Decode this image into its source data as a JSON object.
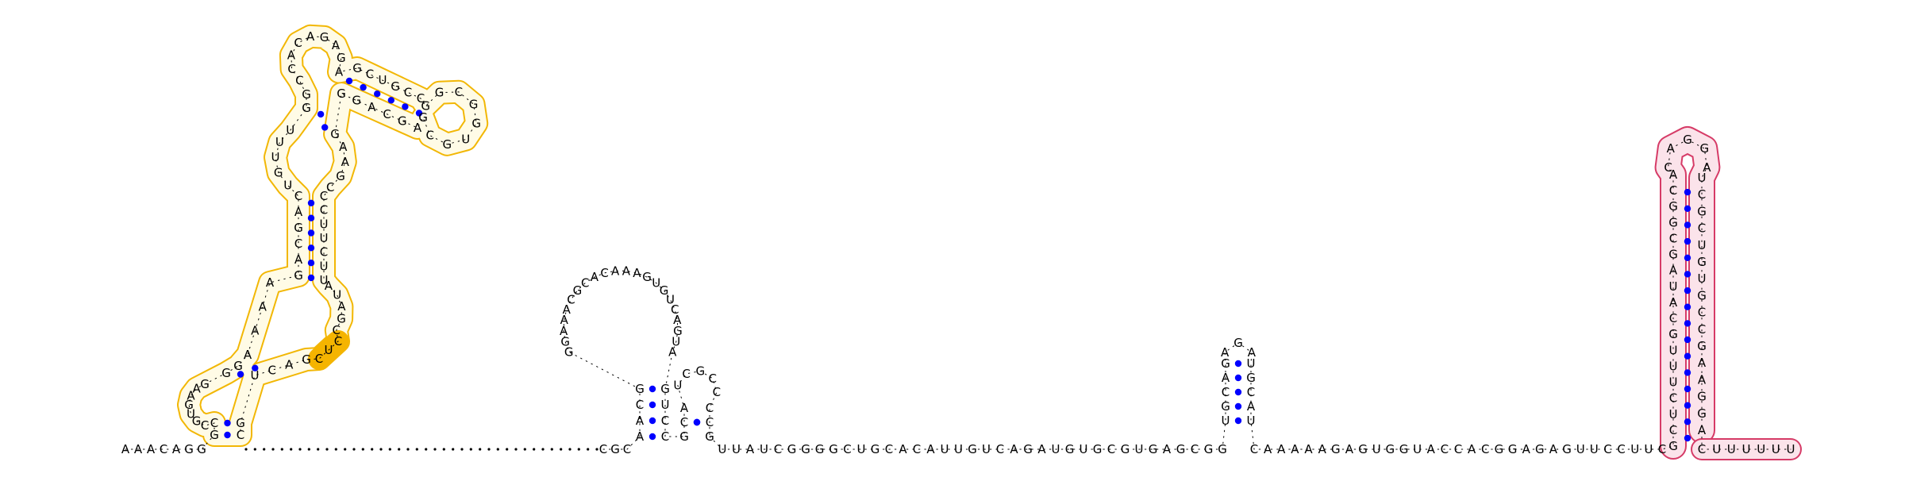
{
  "diagram": {
    "colors": {
      "background": "#ffffff",
      "nucleotide": "#000000",
      "backbone": "#000000",
      "pair": "#0000ff",
      "domain_outline": "#f2b705",
      "domain_fill": "#fffbe6",
      "domain_highlight": "#f5b400",
      "hairpin_outline": "#d63b67",
      "hairpin_fill": "#fbe3ea"
    },
    "leader": "AAACAGG",
    "domain": {
      "basal_5p": "GC",
      "loop1_5p": "CGUGAAG",
      "stem1_5p": "GG",
      "int_5p": "AAAA",
      "stem2_5p": "GACGAC",
      "int2_5p": "UGUUU",
      "stem3_5p": "GG",
      "cap": "CCACAGAGA",
      "arm_5p": "GCUGCC",
      "arm_loop": "GGCGGUGCG",
      "arm_3p": "AGCAGG",
      "int2_3p": "GAAGC",
      "stem2_3p": "CCUUCUU",
      "int_3p": "AUAGC",
      "highlight": "CUC",
      "loop1_3p": "GACU",
      "basal_3p": "GC"
    },
    "gap_count": 40,
    "mid": {
      "pre": "CGC",
      "h1_5p": "AACG",
      "h1_loop": "GGAAACGCACAAAGUGUCAGUA",
      "h1_3p": "GUCC",
      "h2_5p": "GCA",
      "h2_loop": "UCGCC",
      "h2_3p": "CCG"
    },
    "middle_run": "UUAUCGGGGCUGCACAUUGUCAGAUGUGCGUGAGCGG",
    "small_hairpin": {
      "h_5p": "UGCAG",
      "loop": "AGA",
      "h_3p": "UGCAU"
    },
    "tail_run": "CAAAAAGAGUGGUACCACGGAGAGUUCCUUC",
    "terminator": {
      "stem_5p": "GCUCUUUGCAUAGCGGCA",
      "loop": "CAGGA",
      "stem_3p": "UCGCUGUGCCGAAGGA"
    },
    "poly_u": "CUUUUUU"
  }
}
